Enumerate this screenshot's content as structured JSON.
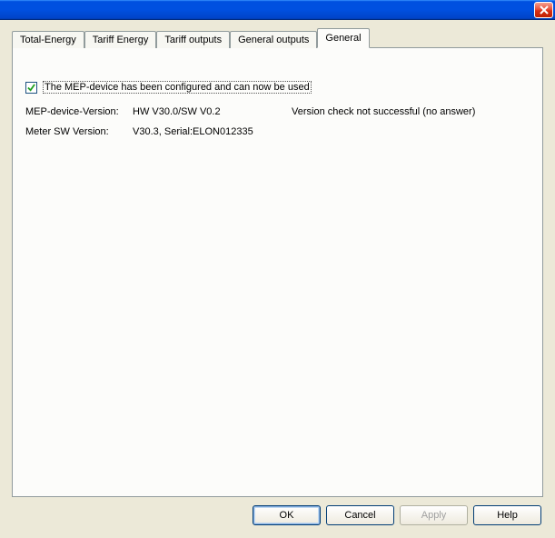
{
  "tabs": {
    "t0": "Total-Energy",
    "t1": "Tariff Energy",
    "t2": "Tariff outputs",
    "t3": "General outputs",
    "t4": "General"
  },
  "panel": {
    "checkbox_label": "The MEP-device has been configured and can now be used",
    "row1": {
      "label": "MEP-device-Version:",
      "value": "HW V30.0/SW V0.2",
      "status": "Version check not successful (no answer)"
    },
    "row2": {
      "label": "Meter SW Version:",
      "value": "V30.3, Serial:ELON012335"
    }
  },
  "buttons": {
    "ok": "OK",
    "cancel": "Cancel",
    "apply": "Apply",
    "help": "Help"
  }
}
